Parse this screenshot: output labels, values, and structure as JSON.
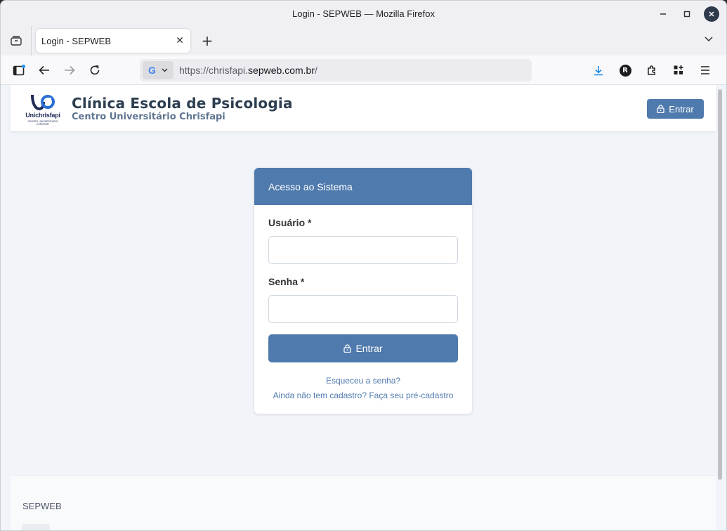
{
  "window": {
    "title": "Login - SEPWEB — Mozilla Firefox"
  },
  "tabs": [
    {
      "label": "Login - SEPWEB"
    }
  ],
  "urlbar": {
    "scheme": "https://chrisfapi.",
    "host": "sepweb.com.br",
    "path": "/",
    "engine_icon": "google-g-icon"
  },
  "header": {
    "logo_text": "Unichrisfapi",
    "logo_tagline": "CENTRO UNIVERSITÁRIO CHRISFAPI",
    "title": "Clínica Escola de Psicologia",
    "subtitle": "Centro Universitário Chrisfapi",
    "login_label": "Entrar"
  },
  "login": {
    "heading": "Acesso ao Sistema",
    "username_label": "Usuário *",
    "username_value": "",
    "password_label": "Senha *",
    "password_value": "",
    "submit_label": "Entrar",
    "forgot_link": "Esqueceu a senha?",
    "register_link": "Ainda não tem cadastro? Faça seu pré-cadastro"
  },
  "footer": {
    "title": "SEPWEB"
  },
  "colors": {
    "primary": "#4f7aad",
    "page_bg": "#f1f4f8",
    "title": "#2c3e50",
    "subtitle": "#5f7590"
  }
}
